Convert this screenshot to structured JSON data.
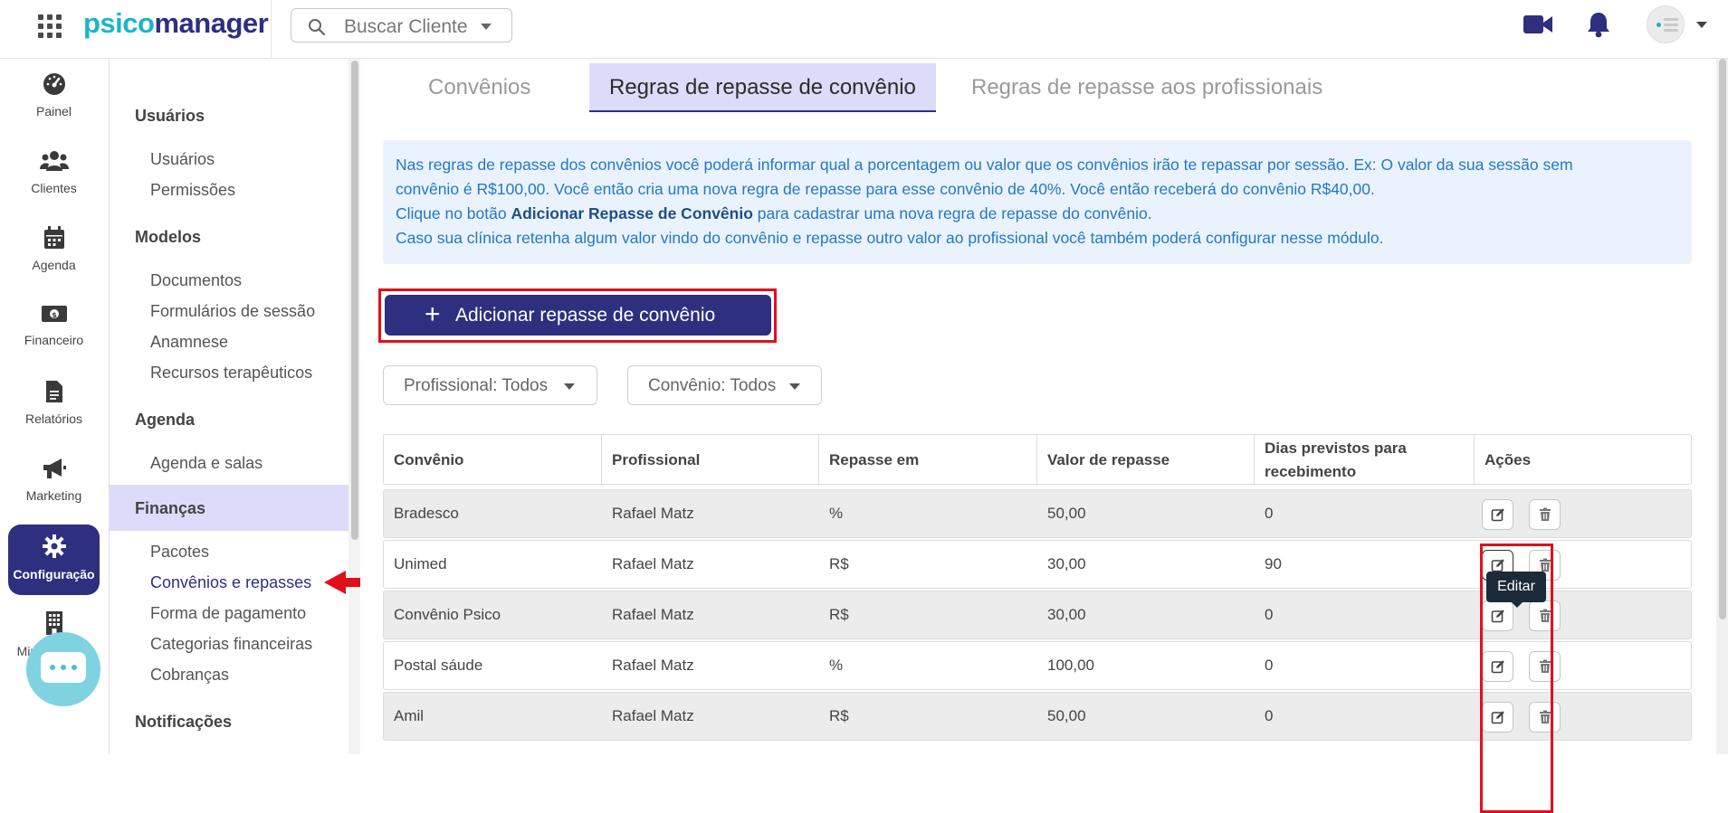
{
  "app": {
    "logo_part1": "psico",
    "logo_part2": "manager",
    "search_placeholder": "Buscar Cliente",
    "icons": [
      "apps-grid-icon",
      "search-icon",
      "video-camera-icon",
      "bell-icon",
      "avatar"
    ]
  },
  "rail": [
    {
      "label": "Painel",
      "icon": "dashboard-gauge-icon"
    },
    {
      "label": "Clientes",
      "icon": "users-icon"
    },
    {
      "label": "Agenda",
      "icon": "calendar-icon"
    },
    {
      "label": "Financeiro",
      "icon": "money-icon"
    },
    {
      "label": "Relatórios",
      "icon": "document-icon"
    },
    {
      "label": "Marketing",
      "icon": "megaphone-icon"
    },
    {
      "label": "Configuração",
      "icon": "gear-icon",
      "active": true
    },
    {
      "label": "Minha clínica",
      "icon": "building-icon"
    }
  ],
  "submenu": {
    "sections": [
      {
        "title": "Usuários",
        "links": [
          "Usuários",
          "Permissões"
        ]
      },
      {
        "title": "Modelos",
        "links": [
          "Documentos",
          "Formulários de sessão",
          "Anamnese",
          "Recursos terapêuticos"
        ]
      },
      {
        "title": "Agenda",
        "links": [
          "Agenda e salas"
        ]
      },
      {
        "title": "Finanças",
        "links": [
          "Pacotes",
          "Convênios e repasses",
          "Forma de pagamento",
          "Categorias financeiras",
          "Cobranças"
        ]
      },
      {
        "title": "Notificações",
        "links": []
      }
    ],
    "current_link": "Convênios e repasses"
  },
  "tabs": [
    "Convênios",
    "Regras de repasse de convênio",
    "Regras de repasse aos profissionais"
  ],
  "active_tab": "Regras de repasse de convênio",
  "info": {
    "line1": "Nas regras de repasse dos convênios você poderá informar qual a porcentagem ou valor que os convênios irão te repassar por sessão. Ex: O valor da sua sessão sem",
    "line2": "convênio é R$100,00. Você então cria uma nova regra de repasse para esse convênio de 40%. Você então receberá do convênio R$40,00.",
    "line3_pre": "Clique no botão ",
    "line3_bold": "Adicionar Repasse de Convênio",
    "line3_post": " para cadastrar uma nova regra de repasse do convênio.",
    "line4": "Caso sua clínica retenha algum valor vindo do convênio e repasse outro valor ao profissional você também poderá configurar nesse módulo."
  },
  "add_button": {
    "plus": "+",
    "label": "Adicionar repasse de convênio"
  },
  "filters": {
    "professional": "Profissional: Todos",
    "insurer": "Convênio: Todos"
  },
  "table": {
    "headers": [
      "Convênio",
      "Profissional",
      "Repasse em",
      "Valor de repasse",
      "Dias previstos para recebimento",
      "Ações"
    ],
    "rows": [
      [
        "Bradesco",
        "Rafael Matz",
        "%",
        "50,00",
        "0"
      ],
      [
        "Unimed",
        "Rafael Matz",
        "R$",
        "30,00",
        "90"
      ],
      [
        "Convênio Psico",
        "Rafael Matz",
        "R$",
        "30,00",
        "0"
      ],
      [
        "Postal sáude",
        "Rafael Matz",
        "%",
        "100,00",
        "0"
      ],
      [
        "Amil",
        "Rafael Matz",
        "R$",
        "50,00",
        "0"
      ]
    ],
    "tooltip": "Editar",
    "action_icons": [
      "edit-icon",
      "trash-icon"
    ]
  },
  "colors": {
    "brand_navy": "#2e2f7f",
    "brand_teal": "#19b5c9",
    "active_tab_bg": "#dcdcfa",
    "info_bg": "#eaf3fd",
    "info_text": "#2477c8",
    "highlight_red": "#e0101b"
  }
}
